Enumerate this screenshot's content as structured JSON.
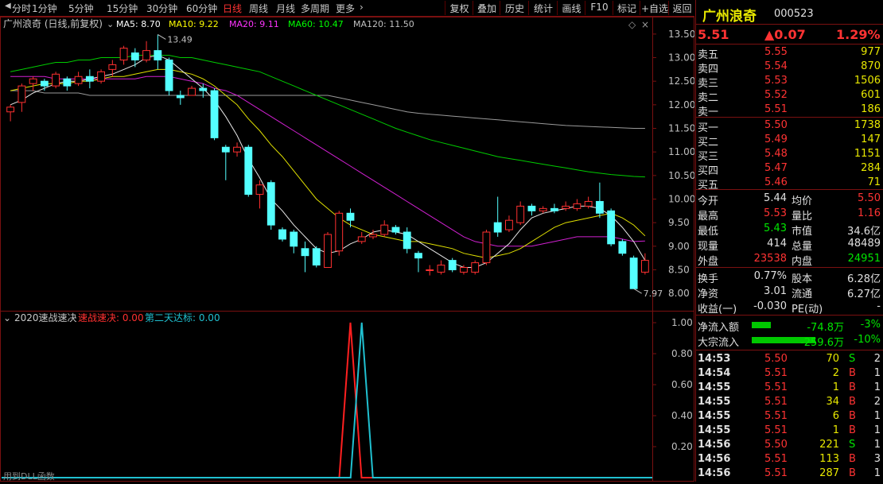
{
  "toolbar": {
    "periods": [
      "分时",
      "1分钟",
      "5分钟",
      "15分钟",
      "30分钟",
      "60分钟",
      "日线",
      "周线",
      "月线",
      "多周期",
      "更多"
    ],
    "active_period": "日线",
    "more_arrow": "chevron-right-icon",
    "buttons": [
      "复权",
      "叠加",
      "历史",
      "统计",
      "画线",
      "F10",
      "标记",
      "+自选",
      "返回"
    ]
  },
  "main_chart": {
    "title": "广州浪奇 (日线,前复权)",
    "ma": [
      {
        "label": "MA5: 8.70",
        "color": "#ffffff"
      },
      {
        "label": "MA10: 9.22",
        "color": "#ffff00"
      },
      {
        "label": "MA20: 9.11",
        "color": "#ff33ff"
      },
      {
        "label": "MA60: 10.47",
        "color": "#00ff00"
      },
      {
        "label": "MA120: 11.50",
        "color": "#c0c0c0"
      }
    ],
    "high_label": "13.49",
    "low_label": "7.97",
    "y_ticks": [
      "13.50",
      "13.00",
      "12.50",
      "12.00",
      "11.50",
      "11.00",
      "10.50",
      "10.00",
      "9.50",
      "9.00",
      "8.50",
      "8.00"
    ]
  },
  "indicator": {
    "name": "2020速战速决",
    "line1": "速战速决: 0.00",
    "line2": "第二天达标: 0.00",
    "y_ticks": [
      "1.00",
      "0.80",
      "0.60",
      "0.40",
      "0.20"
    ],
    "footer": "用到DLL函数"
  },
  "chart_data": {
    "type": "candlestick",
    "ylim": [
      7.8,
      13.7
    ],
    "candles": [
      [
        11.85,
        11.95,
        11.65,
        12.0
      ],
      [
        12.05,
        12.4,
        11.85,
        12.45
      ],
      [
        12.45,
        12.55,
        12.3,
        12.6
      ],
      [
        12.5,
        12.4,
        12.3,
        12.55
      ],
      [
        12.4,
        12.65,
        12.35,
        12.7
      ],
      [
        12.55,
        12.4,
        12.3,
        12.6
      ],
      [
        12.45,
        12.6,
        12.4,
        12.7
      ],
      [
        12.6,
        12.5,
        12.35,
        12.75
      ],
      [
        12.5,
        12.7,
        12.45,
        12.75
      ],
      [
        12.75,
        12.85,
        12.6,
        12.95
      ],
      [
        12.95,
        13.2,
        12.85,
        13.25
      ],
      [
        13.1,
        12.95,
        12.8,
        13.2
      ],
      [
        12.95,
        13.15,
        12.9,
        13.35
      ],
      [
        13.15,
        12.95,
        12.75,
        13.49
      ],
      [
        12.95,
        12.3,
        12.2,
        13.0
      ],
      [
        12.2,
        12.15,
        12.0,
        12.3
      ],
      [
        12.2,
        12.35,
        12.2,
        12.4
      ],
      [
        12.35,
        12.3,
        12.15,
        12.45
      ],
      [
        12.3,
        11.3,
        11.25,
        12.35
      ],
      [
        11.1,
        11.0,
        10.4,
        11.15
      ],
      [
        11.0,
        11.1,
        10.9,
        11.2
      ],
      [
        11.1,
        10.1,
        10.05,
        11.15
      ],
      [
        10.1,
        10.3,
        9.8,
        10.4
      ],
      [
        10.35,
        9.45,
        9.35,
        10.4
      ],
      [
        9.35,
        9.15,
        9.1,
        9.4
      ],
      [
        9.3,
        9.0,
        8.85,
        9.35
      ],
      [
        8.95,
        8.8,
        8.45,
        9.1
      ],
      [
        8.95,
        8.6,
        8.55,
        9.0
      ],
      [
        8.55,
        9.25,
        8.55,
        9.3
      ],
      [
        8.9,
        9.7,
        8.8,
        9.75
      ],
      [
        9.7,
        9.55,
        9.4,
        9.8
      ],
      [
        9.1,
        9.2,
        9.05,
        9.3
      ],
      [
        9.2,
        9.25,
        9.15,
        9.35
      ],
      [
        9.25,
        9.45,
        9.2,
        9.55
      ],
      [
        9.4,
        9.3,
        9.25,
        9.45
      ],
      [
        9.3,
        8.95,
        8.85,
        9.4
      ],
      [
        8.85,
        8.75,
        8.45,
        8.9
      ],
      [
        8.5,
        8.5,
        8.38,
        8.6
      ],
      [
        8.45,
        8.6,
        8.4,
        8.7
      ],
      [
        8.7,
        8.5,
        8.45,
        8.75
      ],
      [
        8.45,
        8.55,
        8.4,
        8.6
      ],
      [
        8.45,
        8.65,
        8.4,
        8.7
      ],
      [
        8.65,
        9.3,
        8.6,
        9.35
      ],
      [
        9.5,
        9.3,
        9.2,
        10.05
      ],
      [
        9.35,
        9.55,
        9.3,
        9.65
      ],
      [
        9.5,
        9.85,
        9.45,
        9.95
      ],
      [
        9.85,
        9.75,
        9.65,
        9.9
      ],
      [
        9.75,
        9.8,
        9.7,
        9.85
      ],
      [
        9.8,
        9.75,
        9.7,
        9.9
      ],
      [
        9.8,
        9.85,
        9.75,
        9.95
      ],
      [
        9.8,
        9.9,
        9.75,
        10.0
      ],
      [
        9.85,
        9.95,
        9.8,
        10.05
      ],
      [
        9.95,
        9.7,
        9.6,
        10.35
      ],
      [
        9.75,
        9.05,
        9.0,
        9.8
      ],
      [
        9.1,
        8.85,
        8.8,
        9.15
      ],
      [
        8.75,
        8.1,
        8.1,
        8.8
      ],
      [
        8.45,
        8.7,
        8.4,
        8.85
      ]
    ],
    "ma5": [
      12.0,
      12.1,
      12.25,
      12.35,
      12.45,
      12.5,
      12.5,
      12.55,
      12.6,
      12.65,
      12.75,
      12.85,
      13.0,
      13.05,
      12.95,
      12.75,
      12.55,
      12.35,
      12.1,
      11.75,
      11.35,
      10.85,
      10.45,
      10.0,
      9.75,
      9.45,
      9.2,
      8.95,
      8.85,
      8.9,
      9.05,
      9.15,
      9.3,
      9.35,
      9.3,
      9.25,
      9.1,
      8.95,
      8.8,
      8.65,
      8.55,
      8.55,
      8.65,
      8.85,
      9.05,
      9.35,
      9.6,
      9.7,
      9.75,
      9.8,
      9.85,
      9.85,
      9.8,
      9.65,
      9.4,
      9.1,
      8.7
    ],
    "ma10": [
      12.3,
      12.35,
      12.4,
      12.45,
      12.45,
      12.45,
      12.5,
      12.5,
      12.55,
      12.6,
      12.6,
      12.65,
      12.7,
      12.75,
      12.75,
      12.7,
      12.65,
      12.55,
      12.4,
      12.2,
      12.0,
      11.7,
      11.45,
      11.15,
      10.9,
      10.6,
      10.3,
      10.0,
      9.8,
      9.6,
      9.45,
      9.35,
      9.25,
      9.2,
      9.15,
      9.1,
      9.1,
      9.05,
      9.0,
      8.95,
      8.85,
      8.8,
      8.75,
      8.8,
      8.85,
      8.95,
      9.1,
      9.25,
      9.4,
      9.5,
      9.55,
      9.6,
      9.65,
      9.7,
      9.6,
      9.45,
      9.22
    ],
    "ma20": [
      12.6,
      12.6,
      12.6,
      12.6,
      12.55,
      12.55,
      12.55,
      12.55,
      12.55,
      12.55,
      12.55,
      12.55,
      12.6,
      12.6,
      12.6,
      12.55,
      12.5,
      12.45,
      12.35,
      12.3,
      12.2,
      12.05,
      11.9,
      11.75,
      11.6,
      11.45,
      11.3,
      11.15,
      11.0,
      10.85,
      10.7,
      10.55,
      10.4,
      10.25,
      10.1,
      9.95,
      9.8,
      9.65,
      9.5,
      9.35,
      9.2,
      9.1,
      9.05,
      9.0,
      9.0,
      9.0,
      9.0,
      9.05,
      9.1,
      9.15,
      9.2,
      9.2,
      9.2,
      9.2,
      9.15,
      9.1,
      9.11
    ],
    "ma60": [
      12.7,
      12.75,
      12.8,
      12.85,
      12.9,
      12.9,
      12.95,
      12.95,
      13.0,
      13.0,
      13.0,
      13.05,
      13.05,
      13.05,
      13.05,
      13.0,
      13.0,
      12.95,
      12.9,
      12.85,
      12.8,
      12.75,
      12.7,
      12.6,
      12.5,
      12.4,
      12.3,
      12.2,
      12.1,
      12.0,
      11.9,
      11.8,
      11.7,
      11.6,
      11.5,
      11.42,
      11.34,
      11.26,
      11.2,
      11.14,
      11.08,
      11.02,
      10.96,
      10.9,
      10.86,
      10.82,
      10.78,
      10.74,
      10.7,
      10.66,
      10.62,
      10.58,
      10.55,
      10.52,
      10.5,
      10.48,
      10.47
    ],
    "ma120": [
      12.3,
      12.3,
      12.3,
      12.25,
      12.25,
      12.25,
      12.25,
      12.2,
      12.2,
      12.2,
      12.2,
      12.2,
      12.2,
      12.2,
      12.2,
      12.2,
      12.2,
      12.2,
      12.2,
      12.2,
      12.2,
      12.2,
      12.2,
      12.2,
      12.2,
      12.2,
      12.2,
      12.2,
      12.2,
      12.15,
      12.1,
      12.05,
      12.0,
      11.95,
      11.9,
      11.85,
      11.82,
      11.8,
      11.78,
      11.76,
      11.74,
      11.72,
      11.7,
      11.68,
      11.66,
      11.64,
      11.62,
      11.6,
      11.58,
      11.56,
      11.55,
      11.54,
      11.53,
      11.52,
      11.51,
      11.5,
      11.5
    ],
    "indicator_series": [
      {
        "name": "速战速决",
        "color": "#ff2020",
        "peaks": [
          {
            "index": 30,
            "value": 1.0
          }
        ]
      },
      {
        "name": "第二天达标",
        "color": "#20c0d0",
        "peaks": [
          {
            "index": 31,
            "value": 1.0
          }
        ]
      }
    ]
  },
  "panel": {
    "stock_name": "广州浪奇",
    "stock_code": "000523",
    "price": "5.51",
    "change": "▲0.07",
    "change_pct": "1.29%",
    "sell": [
      {
        "label": "卖五",
        "price": "5.55",
        "vol": "977"
      },
      {
        "label": "卖四",
        "price": "5.54",
        "vol": "870"
      },
      {
        "label": "卖三",
        "price": "5.53",
        "vol": "1506"
      },
      {
        "label": "卖二",
        "price": "5.52",
        "vol": "601"
      },
      {
        "label": "卖一",
        "price": "5.51",
        "vol": "186"
      }
    ],
    "buy": [
      {
        "label": "买一",
        "price": "5.50",
        "vol": "1738"
      },
      {
        "label": "买二",
        "price": "5.49",
        "vol": "147"
      },
      {
        "label": "买三",
        "price": "5.48",
        "vol": "1151"
      },
      {
        "label": "买四",
        "price": "5.47",
        "vol": "284"
      },
      {
        "label": "买五",
        "price": "5.46",
        "vol": "71"
      }
    ],
    "stats": [
      {
        "l1": "今开",
        "v1": "5.44",
        "c1": "white",
        "l2": "均价",
        "v2": "5.50",
        "c2": "red"
      },
      {
        "l1": "最高",
        "v1": "5.53",
        "c1": "red",
        "l2": "量比",
        "v2": "1.16",
        "c2": "red"
      },
      {
        "l1": "最低",
        "v1": "5.43",
        "c1": "green",
        "l2": "市值",
        "v2": "34.6亿",
        "c2": "white"
      },
      {
        "l1": "现量",
        "v1": "414",
        "c1": "white",
        "l2": "总量",
        "v2": "48489",
        "c2": "white"
      },
      {
        "l1": "外盘",
        "v1": "23538",
        "c1": "red",
        "l2": "内盘",
        "v2": "24951",
        "c2": "green"
      }
    ],
    "stats2": [
      {
        "l1": "换手",
        "v1": "0.77%",
        "l2": "股本",
        "v2": "6.28亿"
      },
      {
        "l1": "净资",
        "v1": "3.01",
        "l2": "流通",
        "v2": "6.27亿"
      },
      {
        "l1": "收益(一)",
        "v1": "-0.030",
        "l2": "PE(动)",
        "v2": "-"
      }
    ],
    "flow": [
      {
        "label": "净流入额",
        "value": "-74.8万",
        "pct": "-3%",
        "bar": 0.3
      },
      {
        "label": "大宗流入",
        "value": "-259.6万",
        "pct": "-10%",
        "bar": 1.0
      }
    ],
    "ticks": [
      {
        "time": "14:53",
        "price": "5.50",
        "vol": "70",
        "bs": "S",
        "n": "2"
      },
      {
        "time": "14:54",
        "price": "5.51",
        "vol": "2",
        "bs": "B",
        "n": "1"
      },
      {
        "time": "14:55",
        "price": "5.51",
        "vol": "1",
        "bs": "B",
        "n": "1"
      },
      {
        "time": "14:55",
        "price": "5.51",
        "vol": "34",
        "bs": "B",
        "n": "2"
      },
      {
        "time": "14:55",
        "price": "5.51",
        "vol": "6",
        "bs": "B",
        "n": "1"
      },
      {
        "time": "14:55",
        "price": "5.51",
        "vol": "1",
        "bs": "B",
        "n": "1"
      },
      {
        "time": "14:56",
        "price": "5.50",
        "vol": "221",
        "bs": "S",
        "n": "1"
      },
      {
        "time": "14:56",
        "price": "5.51",
        "vol": "113",
        "bs": "B",
        "n": "3"
      },
      {
        "time": "14:56",
        "price": "5.51",
        "vol": "287",
        "bs": "B",
        "n": "1"
      }
    ]
  }
}
